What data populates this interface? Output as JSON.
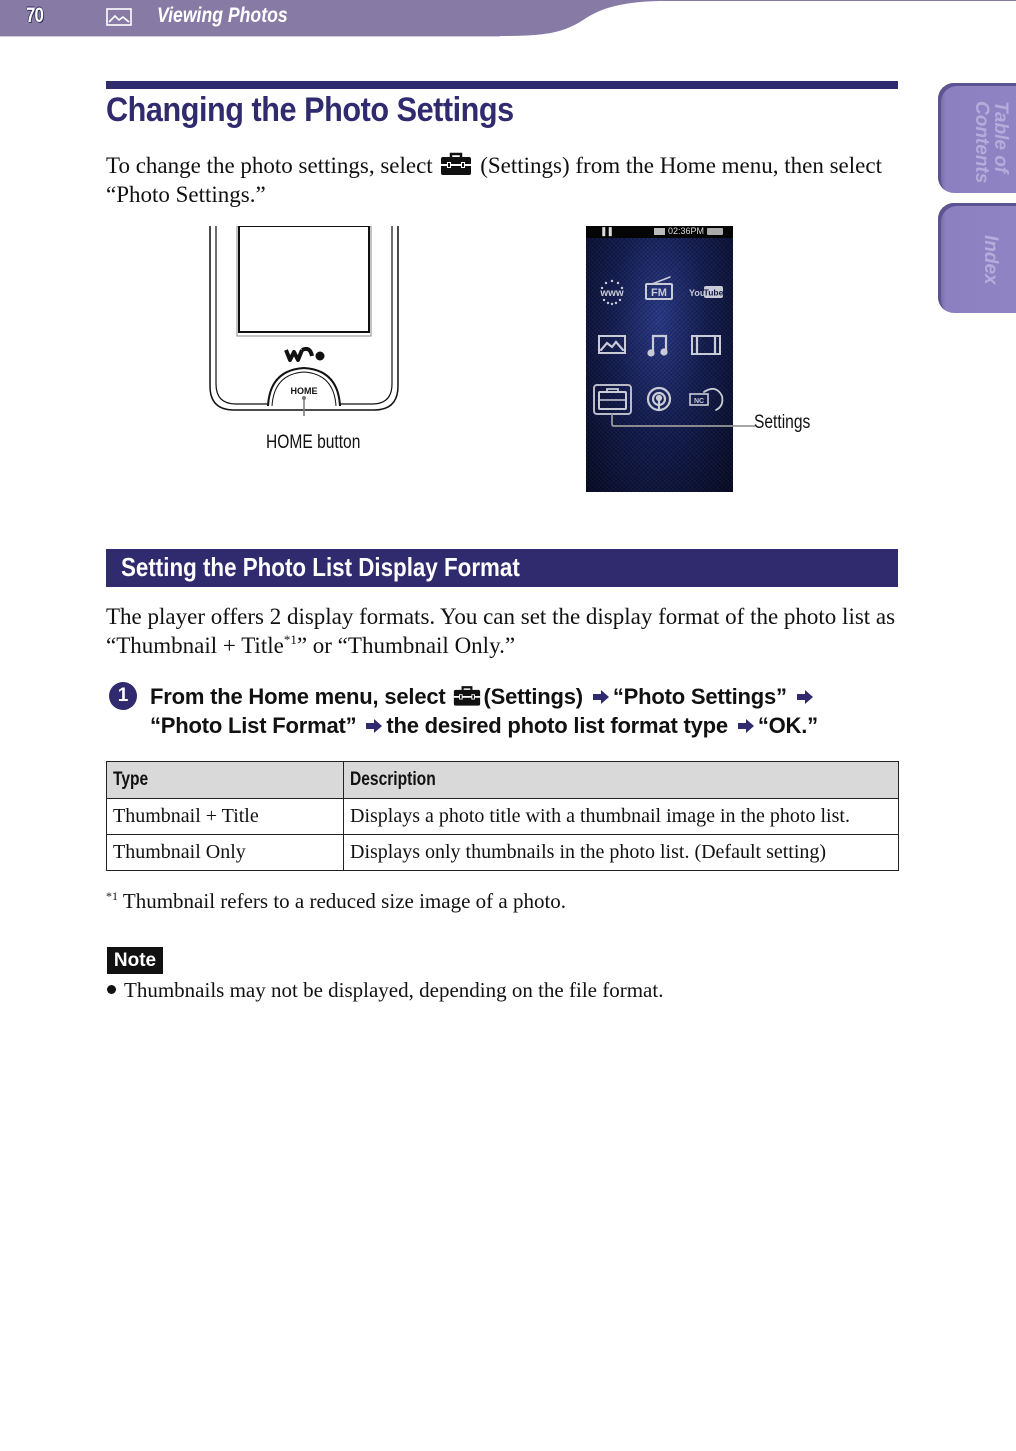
{
  "header": {
    "page_number": "70",
    "section_icon": "photo-icon",
    "section_title": "Viewing Photos",
    "bar_color": "#877ba6"
  },
  "side_tabs": [
    {
      "label": "Table of\nContents"
    },
    {
      "label": "Index"
    }
  ],
  "main": {
    "title": "Changing the Photo Settings",
    "intro_pre": "To change the photo settings, select",
    "intro_post": "(Settings) from the Home menu, then select “Photo Settings.”",
    "settings_icon": "toolbox-icon",
    "figure": {
      "home_button_label": "HOME button",
      "home_key_text": "HOME",
      "settings_label": "Settings",
      "screen_time": "02:36PM",
      "screen_icons": [
        "www",
        "FM",
        "YouTube",
        "Photo",
        "Music",
        "Video",
        "Settings",
        "Podcast",
        "Noise Canceling"
      ]
    },
    "subsection": {
      "title": "Setting the Photo List Display Format",
      "body_pre": "The player offers 2 display formats. You can set the display format of the photo list as “Thumbnail + Title",
      "body_sup": "*1",
      "body_post": "” or “Thumbnail Only.”"
    },
    "step": {
      "number": "1",
      "parts": [
        "From the Home menu, select",
        "(Settings)",
        "“Photo Settings”",
        "“Photo List Format”",
        "the desired photo list format type",
        "“OK.”"
      ]
    },
    "table": {
      "headers": [
        "Type",
        "Description"
      ],
      "rows": [
        [
          "Thumbnail + Title",
          "Displays a photo title with a thumbnail image in the photo list."
        ],
        [
          "Thumbnail Only",
          "Displays only thumbnails in the photo list. (Default setting)"
        ]
      ]
    },
    "footnote": {
      "mark": "*1",
      "text": "Thumbnail refers to a reduced size image of a photo."
    },
    "note": {
      "label": "Note",
      "items": [
        "Thumbnails may not be displayed, depending on the file format."
      ]
    },
    "accent_color": "#302a6e"
  }
}
